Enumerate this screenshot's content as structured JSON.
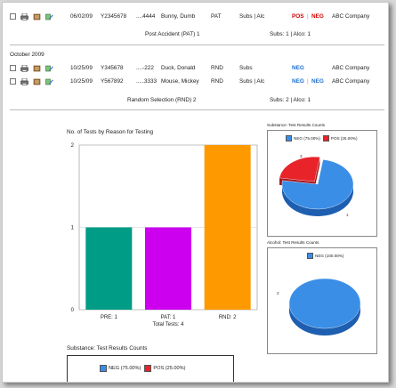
{
  "records_top": [
    {
      "date": "06/02/09",
      "id": "Y2345678",
      "ssn": "....4444",
      "name": "Bunny, Dumb",
      "reason": "PAT",
      "tests": "Subs | Alc",
      "result_pos": "POS",
      "result_sep": "|",
      "result_neg": "NEG",
      "company": "ABC Company"
    }
  ],
  "summary_pat": {
    "label": "Post Accident (PAT) 1",
    "counts": "Subs:  1  |  Alco:  1"
  },
  "month_label": "October 2009",
  "records_oct": [
    {
      "date": "10/25/09",
      "id": "Y345678",
      "ssn": "....-222",
      "name": "Duck, Donald",
      "reason": "RND",
      "tests": "Subs",
      "result_neg": "NEG",
      "company": "ABC Company"
    },
    {
      "date": "10/25/09",
      "id": "Y567892",
      "ssn": ".....3333",
      "name": "Mouse, Mickey",
      "reason": "RND",
      "tests": "Subs | Alc",
      "result_neg": "NEG",
      "result_sep": "|",
      "result_neg2": "NEG",
      "company": "ABC Company"
    }
  ],
  "summary_rnd": {
    "label": "Random Selection (RND) 2",
    "counts": "Subs:  2  |  Alco:  1"
  },
  "bar_chart_title": "No. of Tests by Reason for Testing",
  "bar_chart_footer": "Total Tests: 4",
  "substance_pie_title": "Substance: Test Results Counts",
  "alcohol_pie_title": "Alcohol: Test Results Counts",
  "bottom_section_title": "Substance: Test Results Counts",
  "colors": {
    "teal": "#009c85",
    "magenta": "#cc00ee",
    "orange": "#ff9900",
    "blue": "#3a8ee6",
    "red": "#e8232a"
  },
  "chart_data": [
    {
      "type": "bar",
      "title": "No. of Tests by Reason for Testing",
      "categories": [
        "PRE: 1",
        "PAT: 1",
        "RND: 2"
      ],
      "values": [
        1,
        1,
        2
      ],
      "xlabel": "Total Tests: 4",
      "ylabel": "",
      "ylim": [
        0,
        2
      ],
      "yticks": [
        "0",
        "1",
        "2"
      ],
      "grid": true
    },
    {
      "type": "pie",
      "title": "Substance: Test Results Counts",
      "labels": [
        "NEG (75.00%)",
        "POS (25.00%)"
      ],
      "values": [
        3,
        1
      ],
      "data_labels": [
        "3",
        "1"
      ],
      "legend_position": "top"
    },
    {
      "type": "pie",
      "title": "Alcohol: Test Results Counts",
      "labels": [
        "NEG (100.00%)"
      ],
      "values": [
        2
      ],
      "data_labels": [
        "2"
      ],
      "legend_position": "top"
    }
  ],
  "bottom_legend": [
    {
      "label": "NEG (75.00%)"
    },
    {
      "label": "POS (25.00%)"
    }
  ]
}
